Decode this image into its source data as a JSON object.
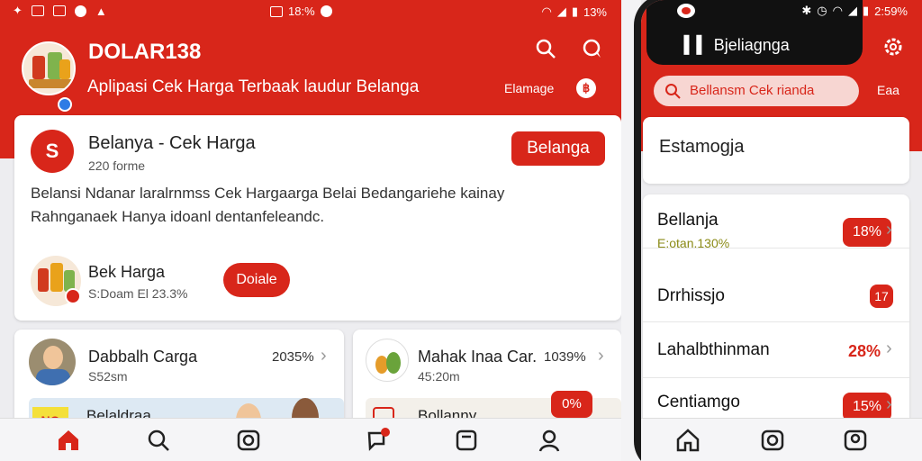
{
  "left": {
    "statusbar": {
      "left_icons": [
        "diamond-icon",
        "mail-icon",
        "image-icon",
        "shield-icon",
        "alert-icon"
      ],
      "center_text": "18:%",
      "right_text": "13%"
    },
    "header": {
      "title": "DOLAR138",
      "subtitle": "Aplipasi Cek Harga Terbaak laudur Belanga",
      "link_text": "Elamage",
      "coin_text": "฿"
    },
    "main_card": {
      "brand_letter": "S",
      "title": "Belanya - Cek Harga",
      "meta": "220 forme",
      "button": "Belanga",
      "description": "Belansi Ndanar laralrnmss Cek Hargaarga Belai Bedangariehe kainay Rahnganaek Hanya idoanl dentanfeleandc.",
      "product_name": "Bek Harga",
      "product_meta": "S:Doam El 23.3%",
      "product_button": "Doiale"
    },
    "card_small_1": {
      "title": "Dabbalh Carga",
      "meta": "S52sm",
      "percent": "2035%",
      "strip_label": "Belaldraa",
      "strip_flag": "NO"
    },
    "card_small_2": {
      "title": "Mahak Inaa Car.",
      "meta": "45:20m",
      "percent": "1039%",
      "strip_label": "Bollanny",
      "pill": "0%"
    },
    "nav": [
      "home-icon",
      "search-icon",
      "camera-icon",
      "chat-icon",
      "wallet-icon",
      "user-icon"
    ]
  },
  "right": {
    "statusbar": {
      "right_text": "2:59%"
    },
    "title": "Bjeliagnga",
    "search_placeholder": "Bellansm Cek rianda",
    "search_link": "Eaa",
    "top_card": "Estamogja",
    "rows": [
      {
        "name": "Bellanja",
        "sub": "E:otan.130%",
        "pill": "18%",
        "pct": ""
      },
      {
        "name": "Drrhissjo",
        "sub": "",
        "pill": "17",
        "pct": ""
      },
      {
        "name": "Lahalbthinman",
        "sub": "",
        "pill": "",
        "pct": "28%"
      },
      {
        "name": "Centiamgo",
        "sub": "",
        "pill": "15%",
        "pct": ""
      }
    ],
    "nav": [
      "home-icon",
      "camera-icon",
      "user-icon"
    ]
  },
  "colors": {
    "primary": "#d8261a",
    "background": "#ededf0",
    "card": "#ffffff"
  }
}
